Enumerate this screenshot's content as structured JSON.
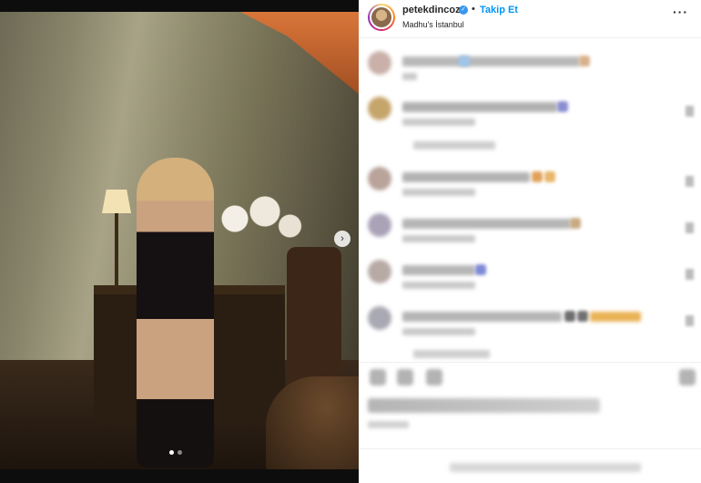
{
  "post": {
    "username": "petekdincoz",
    "verified": true,
    "separator": "•",
    "follow_label": "Takip Et",
    "location": "Madhu's İstanbul",
    "more_label": "···",
    "carousel_next": "›",
    "carousel": {
      "total": 2,
      "active_index": 0
    }
  },
  "colors": {
    "follow_blue": "#0095f6",
    "verified_blue": "#3897f0",
    "text": "#262626"
  },
  "icons": [
    "verified-badge-icon",
    "more-options-icon",
    "chevron-right-icon",
    "heart-icon",
    "comment-icon",
    "share-icon",
    "save-icon"
  ],
  "comments_blurred": true
}
